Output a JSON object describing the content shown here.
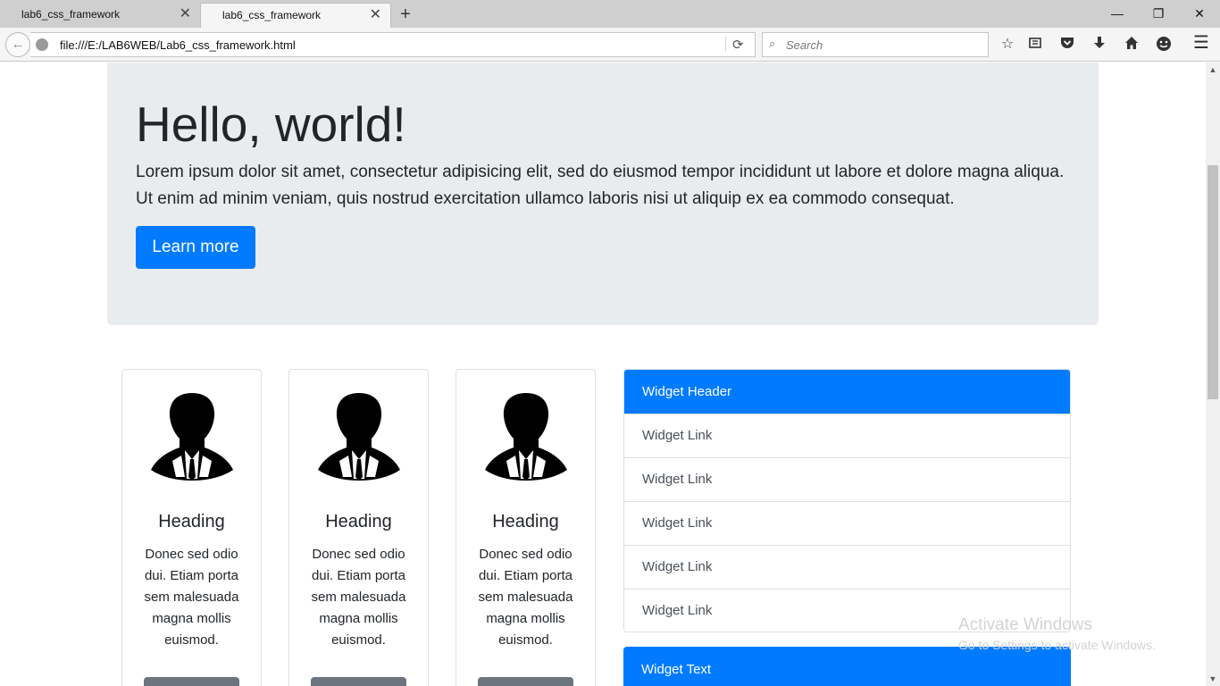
{
  "browser": {
    "tabs": [
      {
        "title": "lab6_css_framework",
        "active": false
      },
      {
        "title": "lab6_css_framework",
        "active": true
      }
    ],
    "new_tab_icon": "+",
    "window_controls": {
      "minimize": "—",
      "restore": "❐",
      "close": "✕"
    },
    "url": "file:///E:/LAB6WEB/Lab6_css_framework.html",
    "search_placeholder": "Search",
    "toolbar_icons": [
      "star-icon",
      "reading-list-icon",
      "pocket-icon",
      "download-icon",
      "home-icon",
      "smiley-icon",
      "menu-icon"
    ]
  },
  "jumbotron": {
    "title": "Hello, world!",
    "lead": "Lorem ipsum dolor sit amet, consectetur adipisicing elit, sed do eiusmod tempor incididunt ut labore et dolore magna aliqua. Ut enim ad minim veniam, quis nostrud exercitation ullamco laboris nisi ut aliquip ex ea commodo consequat.",
    "button_label": "Learn more"
  },
  "cards": [
    {
      "heading": "Heading",
      "text": "Donec sed odio dui. Etiam porta sem malesuada magna mollis euismod."
    },
    {
      "heading": "Heading",
      "text": "Donec sed odio dui. Etiam porta sem malesuada magna mollis euismod."
    },
    {
      "heading": "Heading",
      "text": "Donec sed odio dui. Etiam porta sem malesuada magna mollis euismod."
    }
  ],
  "widget": {
    "header": "Widget Header",
    "links": [
      "Widget Link",
      "Widget Link",
      "Widget Link",
      "Widget Link",
      "Widget Link"
    ]
  },
  "widget_text": {
    "header": "Widget Text"
  },
  "watermark": {
    "title": "Activate Windows",
    "subtitle": "Go to Settings to activate Windows."
  },
  "colors": {
    "primary": "#007bff",
    "jumbotron_bg": "#e9ecef",
    "secondary": "#6c757d"
  }
}
